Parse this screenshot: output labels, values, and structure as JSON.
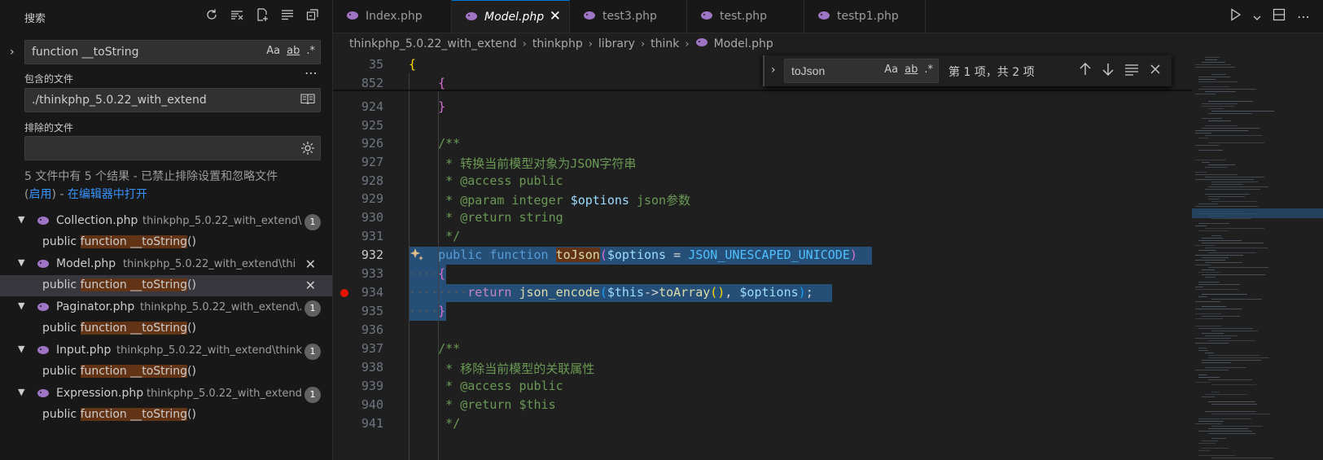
{
  "sidebar": {
    "title": "搜索",
    "search": {
      "value": "function __toString",
      "opt_case": "Aa",
      "opt_word": "ab",
      "opt_regex": ".*"
    },
    "include_label": "包含的文件",
    "include_value": "./thinkphp_5.0.22_with_extend",
    "exclude_label": "排除的文件",
    "exclude_value": "",
    "summary_text": "5 文件中有 5 个结果 - 已禁止排除设置和忽略文件",
    "summary_paren_open": "(",
    "summary_enable": "启用",
    "summary_paren_close": ")",
    "summary_dash": " - ",
    "summary_open_editor": "在编辑器中打开",
    "results": [
      {
        "file": "Collection.php",
        "path": "thinkphp_5.0.22_with_extend\\...",
        "count": "1",
        "match_pre": "public ",
        "match_hit": "function __toString",
        "match_post": "()"
      },
      {
        "file": "Model.php",
        "path": "thinkphp_5.0.22_with_extend\\thi...",
        "count": "",
        "match_pre": "public ",
        "match_hit": "function __toString",
        "match_post": "()"
      },
      {
        "file": "Paginator.php",
        "path": "thinkphp_5.0.22_with_extend\\...",
        "count": "1",
        "match_pre": "public ",
        "match_hit": "function __toString",
        "match_post": "()"
      },
      {
        "file": "Input.php",
        "path": "thinkphp_5.0.22_with_extend\\think...",
        "count": "1",
        "match_pre": "public ",
        "match_hit": "function __toString",
        "match_post": "()"
      },
      {
        "file": "Expression.php",
        "path": "thinkphp_5.0.22_with_extend...",
        "count": "1",
        "match_pre": "public ",
        "match_hit": "function __toString",
        "match_post": "()"
      }
    ]
  },
  "tabs": [
    {
      "label": "Index.php"
    },
    {
      "label": "Model.php"
    },
    {
      "label": "test3.php"
    },
    {
      "label": "test.php"
    },
    {
      "label": "testp1.php"
    }
  ],
  "breadcrumb": [
    "thinkphp_5.0.22_with_extend",
    "thinkphp",
    "library",
    "think",
    "Model.php"
  ],
  "find": {
    "value": "toJson",
    "opt_case": "Aa",
    "opt_word": "ab",
    "opt_regex": ".*",
    "count": "第 1 项，共 2 项"
  },
  "code": {
    "lines": [
      {
        "n": "35"
      },
      {
        "n": "852"
      },
      {
        "n": "924"
      },
      {
        "n": "925"
      },
      {
        "n": "926"
      },
      {
        "n": "927"
      },
      {
        "n": "928"
      },
      {
        "n": "929"
      },
      {
        "n": "930"
      },
      {
        "n": "931"
      },
      {
        "n": "932"
      },
      {
        "n": "933"
      },
      {
        "n": "934"
      },
      {
        "n": "935"
      },
      {
        "n": "936"
      },
      {
        "n": "937"
      },
      {
        "n": "938"
      },
      {
        "n": "939"
      },
      {
        "n": "940"
      },
      {
        "n": "941"
      }
    ],
    "t927": "* 转换当前模型对象为JSON字符串",
    "t928": "* @access public",
    "t929_a": "* @param integer ",
    "t929_b": "$options",
    "t929_c": " json参数",
    "t930": "* @return string",
    "t938": "* 移除当前模型的关联属性",
    "t939": "* @access public",
    "t940": "* @return $this"
  },
  "colors": {
    "accent": "#0078d4",
    "match": "#623315",
    "selection": "#264f78",
    "breakpoint": "#e51400"
  }
}
